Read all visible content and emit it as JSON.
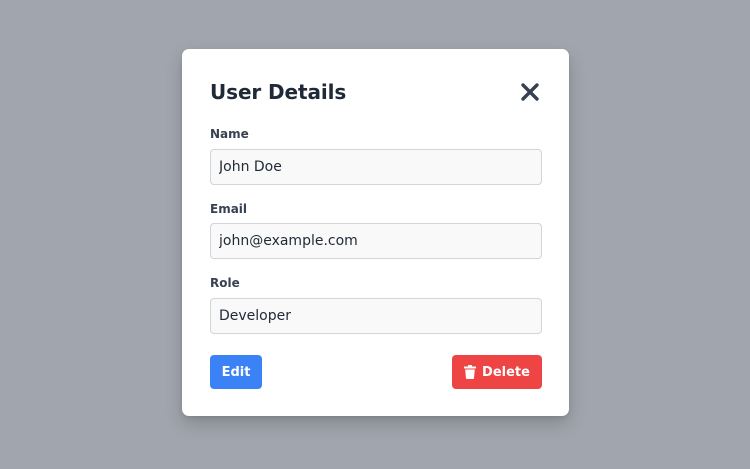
{
  "modal": {
    "title": "User Details",
    "close_icon": "close-icon"
  },
  "fields": {
    "name": {
      "label": "Name",
      "value": "John Doe"
    },
    "email": {
      "label": "Email",
      "value": "john@example.com"
    },
    "role": {
      "label": "Role",
      "value": "Developer"
    }
  },
  "actions": {
    "edit_label": "Edit",
    "delete_label": "Delete",
    "delete_icon": "trash-icon"
  },
  "colors": {
    "backdrop": "#a1a6ae",
    "edit_button": "#3b82f6",
    "delete_button": "#ef4444",
    "title": "#1f2937"
  }
}
